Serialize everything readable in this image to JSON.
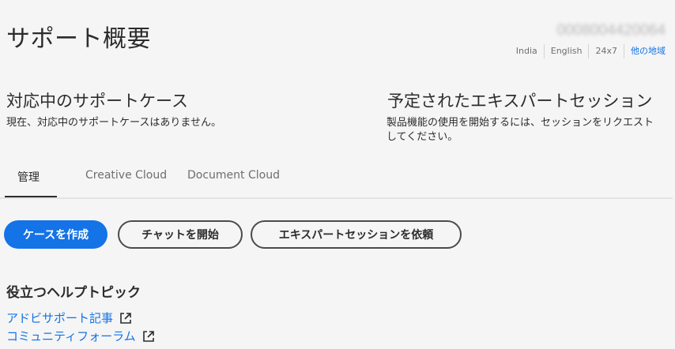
{
  "header": {
    "title": "サポート概要",
    "account_id": "0008004420064",
    "meta": {
      "country": "India",
      "language": "English",
      "availability": "24x7",
      "other_regions": "他の地域"
    }
  },
  "cases": {
    "heading": "対応中のサポートケース",
    "text": "現在、対応中のサポートケースはありません。"
  },
  "sessions": {
    "heading": "予定されたエキスパートセッション",
    "text": "製品機能の使用を開始するには、セッションをリクエストしてください。"
  },
  "tabs": [
    {
      "label": "管理"
    },
    {
      "label": "Creative Cloud"
    },
    {
      "label": "Document Cloud"
    }
  ],
  "actions": {
    "create_case": "ケースを作成",
    "start_chat": "チャットを開始",
    "request_session": "エキスパートセッションを依頼"
  },
  "help_topics": {
    "heading": "役立つヘルプトピック",
    "links": [
      {
        "label": "アドビサポート記事",
        "icon": "external-link-icon"
      },
      {
        "label": "コミュニティフォーラム",
        "icon": "external-link-icon"
      }
    ]
  },
  "colors": {
    "accent": "#1473e6",
    "background": "#f5f5f5",
    "text": "#2c2c2c"
  }
}
